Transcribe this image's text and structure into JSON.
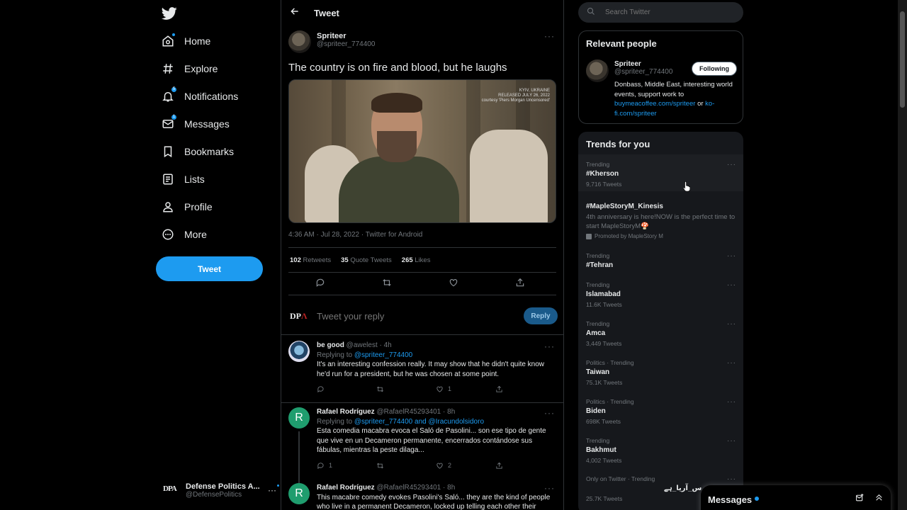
{
  "nav": {
    "items": [
      {
        "label": "Home",
        "icon": "home-icon"
      },
      {
        "label": "Explore",
        "icon": "hashtag-icon"
      },
      {
        "label": "Notifications",
        "icon": "bell-icon",
        "badge": "5"
      },
      {
        "label": "Messages",
        "icon": "envelope-icon",
        "badge": "1"
      },
      {
        "label": "Bookmarks",
        "icon": "bookmark-icon"
      },
      {
        "label": "Lists",
        "icon": "list-icon"
      },
      {
        "label": "Profile",
        "icon": "person-icon"
      },
      {
        "label": "More",
        "icon": "more-circle-icon"
      }
    ],
    "tweet_button": "Tweet",
    "account": {
      "logo": "DPA",
      "name": "Defense Politics A...",
      "handle": "@DefensePolitics",
      "more": "···"
    }
  },
  "header": {
    "title": "Tweet"
  },
  "tweet": {
    "author_name": "Spriteer",
    "author_handle": "@spriteer_774400",
    "text": "The country is on fire and blood, but he laughs",
    "media_watermark": [
      "KYIV, UKRAINE",
      "RELEASED JULY 26, 2022",
      "courtesy 'Piers Morgan Uncensored'"
    ],
    "timestamp": "4:36 AM · Jul 28, 2022 · Twitter for Android",
    "retweets": "102",
    "retweets_label": "Retweets",
    "quotes": "35",
    "quotes_label": "Quote Tweets",
    "likes": "265",
    "likes_label": "Likes",
    "reply_placeholder": "Tweet your reply",
    "reply_button": "Reply"
  },
  "replies": [
    {
      "name": "be good",
      "meta": "@awelest · 4h",
      "replying_prefix": "Replying to",
      "replying_to": "@spriteer_774400",
      "text": "It's an interesting confession really. It may show that he didn't quite know he'd run for a president, but he was chosen at some point.",
      "likes": "1",
      "retweets": "",
      "comments": ""
    },
    {
      "name": "Rafael Rodríguez",
      "meta": "@RafaelR45293401 · 8h",
      "replying_prefix": "Replying to",
      "replying_to": "@spriteer_774400 and @Iracundolsidoro",
      "text": "Esta comedia macabra evoca el Saló de Pasolini... son ese tipo de gente que vive en un Decameron permanente, encerrados contándose sus fábulas, mientras la peste dilaga...",
      "comments": "1",
      "likes": "2",
      "avatar_letter": "R"
    },
    {
      "name": "Rafael Rodríguez",
      "meta": "@RafaelR45293401 · 8h",
      "text": "This macabre comedy evokes Pasolini's Saló... they are the kind of people who live in a permanent Decameron, locked up telling each other their",
      "avatar_letter": "R"
    }
  ],
  "right": {
    "search_placeholder": "Search Twitter",
    "relevant": {
      "title": "Relevant people",
      "name": "Spriteer",
      "handle": "@spriteer_774400",
      "follow_button": "Following",
      "bio_text": "Donbass, Middle East, interesting world events, support work to",
      "bio_link1": "buymeacoffee.com/spriteer",
      "bio_or": "or",
      "bio_link2": "ko-fi.com/spriteer"
    },
    "trends_title": "Trends for you",
    "trends": [
      {
        "cat": "Trending",
        "name": "#Kherson",
        "count": "9,716 Tweets"
      },
      {
        "cat": "",
        "name": "#MapleStoryM_Kinesis",
        "promo": "4th anniversary is here!NOW is the perfect time to start MapleStoryM🍄",
        "promoted_by": "Promoted by MapleStory M"
      },
      {
        "cat": "Trending",
        "name": "#Tehran",
        "count": ""
      },
      {
        "cat": "Trending",
        "name": "Islamabad",
        "count": "11.6K Tweets"
      },
      {
        "cat": "Trending",
        "name": "Amca",
        "count": "3,449 Tweets"
      },
      {
        "cat": "Politics · Trending",
        "name": "Taiwan",
        "count": "75.1K Tweets"
      },
      {
        "cat": "Politics · Trending",
        "name": "Biden",
        "count": "698K Tweets"
      },
      {
        "cat": "Trending",
        "name": "Bakhmut",
        "count": "4,002 Tweets"
      },
      {
        "cat": "Only on Twitter · Trending",
        "name": "س_آریا_ہے",
        "count": "25.7K Tweets"
      }
    ]
  },
  "messages_drawer": {
    "title": "Messages"
  },
  "colors": {
    "accent": "#1d9bf0",
    "background": "#000000",
    "text": "#e7e9ea",
    "muted": "#71767b"
  }
}
